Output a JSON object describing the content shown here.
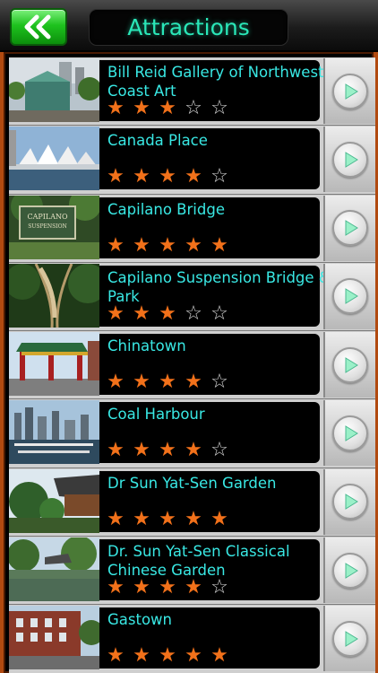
{
  "header": {
    "title": "Attractions",
    "back_icon": "double-chevron-left-icon"
  },
  "colors": {
    "accent_text": "#39e8e4",
    "title_text": "#2ae7b8",
    "star_full": "#f2711a",
    "star_empty": "#d8d8d8",
    "back_button": "#1ec21e",
    "frame": "#b14a10"
  },
  "attractions": [
    {
      "name": "Bill Reid Gallery of Northwest Coast Art",
      "rating": 3,
      "thumb": "gallery-building"
    },
    {
      "name": "Canada Place",
      "rating": 4,
      "thumb": "sails-waterfront"
    },
    {
      "name": "Capilano Bridge",
      "rating": 5,
      "thumb": "park-sign"
    },
    {
      "name": "Capilano Suspension Bridge & Park",
      "rating": 3,
      "thumb": "suspension-bridge"
    },
    {
      "name": "Chinatown",
      "rating": 4,
      "thumb": "chinatown-gate"
    },
    {
      "name": "Coal Harbour",
      "rating": 4,
      "thumb": "marina-skyline"
    },
    {
      "name": "Dr Sun Yat-Sen Garden",
      "rating": 5,
      "thumb": "pagoda-garden"
    },
    {
      "name": "Dr. Sun Yat-Sen Classical Chinese Garden",
      "rating": 4,
      "thumb": "pond-garden"
    },
    {
      "name": "Gastown",
      "rating": 5,
      "thumb": "brick-street"
    }
  ]
}
